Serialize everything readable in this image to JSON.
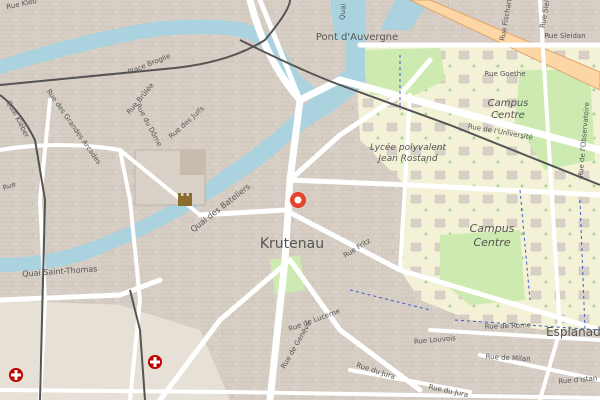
{
  "map": {
    "district": "Krutenau",
    "campus_label_1": "Campus",
    "campus_label_2": "Centre",
    "lycee_line1": "Lycée polyvalent",
    "lycee_line2": "Jean Rostand",
    "esplanade_partial": "Esplanad",
    "colors": {
      "background": "#f2efe9",
      "water": "#aad3df",
      "block": "#e0d8d0",
      "block_edge": "#c8bfb6",
      "park": "#cdebb0",
      "campus": "#ffffe5",
      "tram": "#555555",
      "highway": "#fcd6a4",
      "marker": "#e8412c",
      "hospital": "#bf0000"
    }
  },
  "streets": {
    "pont_auvergne": "Pont d'Auvergne",
    "place_broglie": "Place Broglie",
    "rue_brulee": "Rue Brûlée",
    "rue_grandes_arcades": "Rue des Grandes Arcades",
    "rue_du_dome": "Rue du Dôme",
    "rue_des_juifs": "Rue des Juifs",
    "quai_kleber": "Quai Kléber",
    "rue_partial": "Rue",
    "quai_saint_thomas": "Quai Saint-Thomas",
    "quai_des_bateliers": "Quai des Bateliers",
    "rue_fritz": "Rue Fritz",
    "rue_de_lucerne": "Rue de Lucerne",
    "rue_de_geneve": "Rue de Genève",
    "rue_du_jura": "Rue du Jura",
    "rue_du_jura_2": "Rue du Jura",
    "rue_de_rome": "Rue de Rome",
    "rue_louvois": "Rue Louvois",
    "rue_de_milan": "Rue de Milan",
    "rue_goethe": "Rue Goethe",
    "rue_universite": "Rue de l'Université",
    "rue_observatoire": "Rue de l'Observatoire",
    "rue_fischart": "Rue Fischart",
    "rue_sleidan": "Rue Sleidan",
    "rue_sleidan_2": "Rue Sleidan",
    "rue_d_istan": "Rue d'Istan",
    "rue_kleber_top": "Rue Kléb",
    "quai_top": "Quai"
  }
}
